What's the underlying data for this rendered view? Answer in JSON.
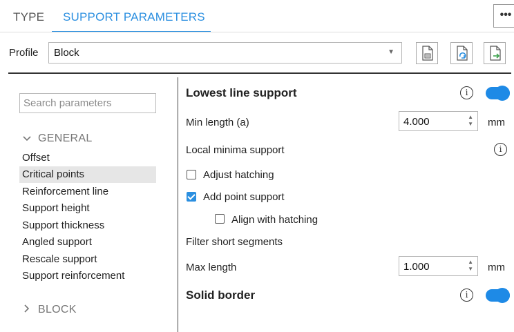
{
  "tabs": [
    {
      "label": "TYPE",
      "active": false
    },
    {
      "label": "SUPPORT PARAMETERS",
      "active": true
    }
  ],
  "more_label": "•••",
  "profile": {
    "label": "Profile",
    "value": "Block"
  },
  "file_buttons": [
    "new-profile-icon",
    "reload-profile-icon",
    "export-profile-icon"
  ],
  "search": {
    "placeholder": "Search parameters"
  },
  "groups": [
    {
      "label": "GENERAL",
      "expanded": true,
      "items": [
        "Offset",
        "Critical points",
        "Reinforcement line",
        "Support height",
        "Support thickness",
        "Angled support",
        "Rescale support",
        "Support reinforcement"
      ],
      "selected": "Critical points"
    },
    {
      "label": "BLOCK",
      "expanded": false
    }
  ],
  "params": {
    "lowest_line": {
      "title": "Lowest line support",
      "enabled": true
    },
    "min_length": {
      "label": "Min length (a)",
      "value": "4.000",
      "unit": "mm"
    },
    "local_minima": {
      "label": "Local minima support"
    },
    "adjust_hatching": {
      "label": "Adjust hatching",
      "checked": false
    },
    "add_point_support": {
      "label": "Add point support",
      "checked": true
    },
    "align_with_hatching": {
      "label": "Align with hatching",
      "checked": false
    },
    "filter_short": {
      "label": "Filter short segments"
    },
    "max_length": {
      "label": "Max length",
      "value": "1.000",
      "unit": "mm"
    },
    "solid_border": {
      "title": "Solid border",
      "enabled": true
    }
  },
  "colors": {
    "accent": "#2b8fe0",
    "toggle": "#1e8ae6",
    "selected_row": "#e6e6e6"
  }
}
